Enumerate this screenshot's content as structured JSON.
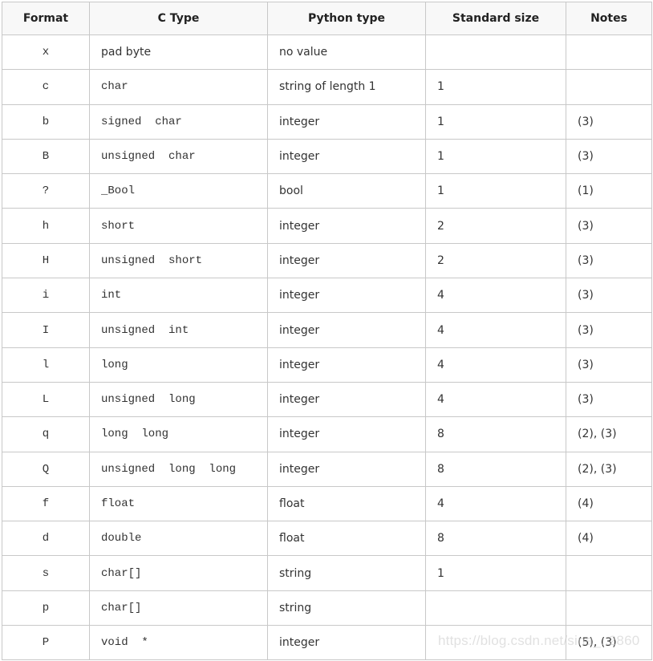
{
  "table": {
    "headers": [
      "Format",
      "C Type",
      "Python type",
      "Standard size",
      "Notes"
    ],
    "rows": [
      {
        "format": "x",
        "ctype": "pad byte",
        "ctype_plain": true,
        "pytype": "no value",
        "size": "",
        "notes": ""
      },
      {
        "format": "c",
        "ctype": "char",
        "pytype": "string of length 1",
        "size": "1",
        "notes": ""
      },
      {
        "format": "b",
        "ctype": "signed  char",
        "pytype": "integer",
        "size": "1",
        "notes": "(3)"
      },
      {
        "format": "B",
        "ctype": "unsigned  char",
        "pytype": "integer",
        "size": "1",
        "notes": "(3)"
      },
      {
        "format": "?",
        "ctype": "_Bool",
        "pytype": "bool",
        "size": "1",
        "notes": "(1)"
      },
      {
        "format": "h",
        "ctype": "short",
        "pytype": "integer",
        "size": "2",
        "notes": "(3)"
      },
      {
        "format": "H",
        "ctype": "unsigned  short",
        "pytype": "integer",
        "size": "2",
        "notes": "(3)"
      },
      {
        "format": "i",
        "ctype": "int",
        "pytype": "integer",
        "size": "4",
        "notes": "(3)"
      },
      {
        "format": "I",
        "ctype": "unsigned  int",
        "pytype": "integer",
        "size": "4",
        "notes": "(3)"
      },
      {
        "format": "l",
        "ctype": "long",
        "pytype": "integer",
        "size": "4",
        "notes": "(3)"
      },
      {
        "format": "L",
        "ctype": "unsigned  long",
        "pytype": "integer",
        "size": "4",
        "notes": "(3)"
      },
      {
        "format": "q",
        "ctype": "long  long",
        "pytype": "integer",
        "size": "8",
        "notes": "(2), (3)"
      },
      {
        "format": "Q",
        "ctype": "unsigned  long  long",
        "pytype": "integer",
        "size": "8",
        "notes": "(2), (3)"
      },
      {
        "format": "f",
        "ctype": "float",
        "pytype": "float",
        "size": "4",
        "notes": "(4)"
      },
      {
        "format": "d",
        "ctype": "double",
        "pytype": "float",
        "size": "8",
        "notes": "(4)"
      },
      {
        "format": "s",
        "ctype": "char[]",
        "pytype": "string",
        "size": "1",
        "notes": ""
      },
      {
        "format": "p",
        "ctype": "char[]",
        "pytype": "string",
        "size": "",
        "notes": ""
      },
      {
        "format": "P",
        "ctype": "void  *",
        "pytype": "integer",
        "size": "",
        "notes": "(5), (3)"
      }
    ]
  },
  "watermark": "https://blog.csdn.net/sina_..2860",
  "colors": {
    "border": "#c8c8c8",
    "header_bg": "#f8f8f8",
    "text": "#333333"
  }
}
